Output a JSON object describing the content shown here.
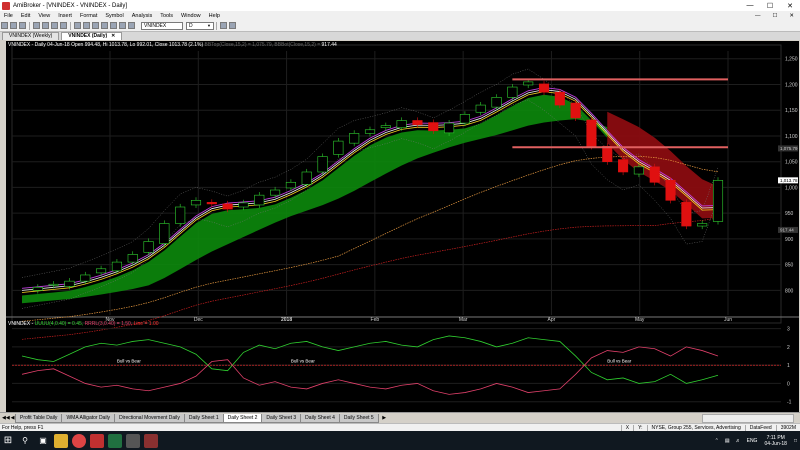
{
  "window": {
    "title": "AmiBroker - [VNINDEX - VNINDEX - Daily]",
    "minimize": "—",
    "maximize": "☐",
    "close": "✕"
  },
  "menu": [
    "File",
    "Edit",
    "View",
    "Insert",
    "Format",
    "Symbol",
    "Analysis",
    "Tools",
    "Window",
    "Help"
  ],
  "toolbar": {
    "symbol_value": "VNINDEX",
    "interval_value": "D"
  },
  "doc_tabs": [
    {
      "label": "VNINDEX (Weekly)",
      "active": false
    },
    {
      "label": "VNINDEX (Daily)",
      "active": true
    }
  ],
  "chart": {
    "title_main": "VNINDEX - Daily 04-Jun-18 Open 994.48, Hi 1013.78, Lo 992.01, Close 1013.78 (2.1%)",
    "title_dim": " BBTop(Close,15,2) = 1,075.79, BBBot(Close,15,2) =",
    "title_value": " 917.44",
    "price_flag_1": "1,075.79",
    "price_flag_2": "1,013.78",
    "price_flag_3": "917.44",
    "bull_bear_label": "Bull vs Bear",
    "indicator_title": {
      "name": "VNINDEX - ",
      "green": "UUUU(4,0.40) = 0.45, ",
      "pink": "RRRL(3,0.40) = 1.50, ",
      "red": "Line = 1.00"
    }
  },
  "chart_data": [
    {
      "type": "candlestick",
      "title": "VNINDEX - Daily 04-Jun-18 Open 994.48, Hi 1013.78, Lo 992.01, Close 1013.78 (2.1%)",
      "xlabel": "",
      "ylabel": "",
      "x_tick_labels": [
        "Nov",
        "Dec",
        "2018",
        "Feb",
        "Mar",
        "Apr",
        "May",
        "Jun"
      ],
      "y_ticks": [
        800,
        850,
        900,
        950,
        1000,
        1050,
        1100,
        1150,
        1200,
        1250
      ],
      "y_tick_labels": [
        "800",
        "850",
        "900",
        "950",
        "1,000",
        "1,050",
        "1,100",
        "1,150",
        "1,200",
        "1,250"
      ],
      "ylim": [
        760,
        1265
      ],
      "close_series": [
        800,
        806,
        812,
        818,
        830,
        842,
        855,
        870,
        895,
        930,
        962,
        975,
        968,
        958,
        970,
        985,
        995,
        1010,
        1030,
        1060,
        1090,
        1105,
        1112,
        1120,
        1130,
        1122,
        1110,
        1125,
        1142,
        1160,
        1175,
        1195,
        1205,
        1185,
        1160,
        1135,
        1080,
        1050,
        1030,
        1040,
        1010,
        975,
        925,
        930,
        1013.78
      ],
      "bands": {
        "bb_top_last": 1075.79,
        "bb_bot_last": 917.44
      },
      "resistance_lines": [
        1210,
        1078
      ],
      "grid": true
    },
    {
      "type": "line",
      "title": "VNINDEX - UUUU(4,0.40) = 0.45, RRRL(3,0.40) = 1.50, Line = 1.00",
      "y_ticks": [
        -1,
        0,
        1,
        2,
        3
      ],
      "y_tick_labels": [
        "-1",
        "0",
        "1",
        "2",
        "3"
      ],
      "ylim": [
        -1.4,
        3.2
      ],
      "series": [
        {
          "name": "UUUU(4,0.40)",
          "color": "#30d030",
          "last": 0.45,
          "values": [
            1.5,
            1.3,
            1.2,
            1.6,
            2.0,
            2.2,
            2.1,
            2.3,
            2.4,
            2.2,
            2.0,
            1.6,
            0.8,
            0.7,
            1.7,
            2.1,
            1.9,
            2.2,
            2.3,
            2.0,
            1.8,
            2.0,
            2.2,
            2.3,
            2.1,
            2.0,
            2.4,
            2.6,
            2.5,
            2.3,
            2.0,
            2.2,
            2.5,
            2.4,
            2.3,
            1.5,
            0.6,
            0.2,
            0.3,
            0.0,
            0.1,
            0.5,
            0.0,
            0.2,
            0.45
          ]
        },
        {
          "name": "RRRL(3,0.40)",
          "color": "#e0406a",
          "last": 1.5,
          "values": [
            0.5,
            0.7,
            0.8,
            0.4,
            0.0,
            -0.2,
            -0.1,
            -0.3,
            -0.4,
            -0.2,
            0.0,
            0.4,
            1.2,
            1.3,
            0.3,
            -0.1,
            0.1,
            -0.2,
            -0.3,
            0.0,
            0.2,
            0.0,
            -0.2,
            -0.3,
            -0.1,
            0.0,
            -0.4,
            -0.6,
            -0.5,
            -0.3,
            0.0,
            -0.2,
            -0.5,
            -0.4,
            -0.3,
            0.5,
            1.4,
            1.8,
            1.7,
            2.0,
            1.9,
            1.5,
            2.0,
            1.8,
            1.5
          ]
        },
        {
          "name": "Line",
          "color": "#ff3030",
          "last": 1.0
        }
      ],
      "annotation": "Bull vs Bear"
    }
  ],
  "sheets": [
    "Profit Table Daily",
    "WMA Alligator Daily",
    "Directional Movement Daily",
    "Daily Sheet 1",
    "Daily Sheet 2",
    "Daily Sheet 3",
    "Daily Sheet 4",
    "Daily Sheet 5"
  ],
  "sheet_active": "Daily Sheet 2",
  "status": {
    "left": "For Help, press F1",
    "fields": [
      "X",
      "Y:",
      "NYSE, Group 255, Services, Advertising",
      "DataFeed",
      "3902M"
    ]
  },
  "taskbar": {
    "time": "7:11 PM",
    "date": "04-Jun-18",
    "lang": "ENG"
  }
}
